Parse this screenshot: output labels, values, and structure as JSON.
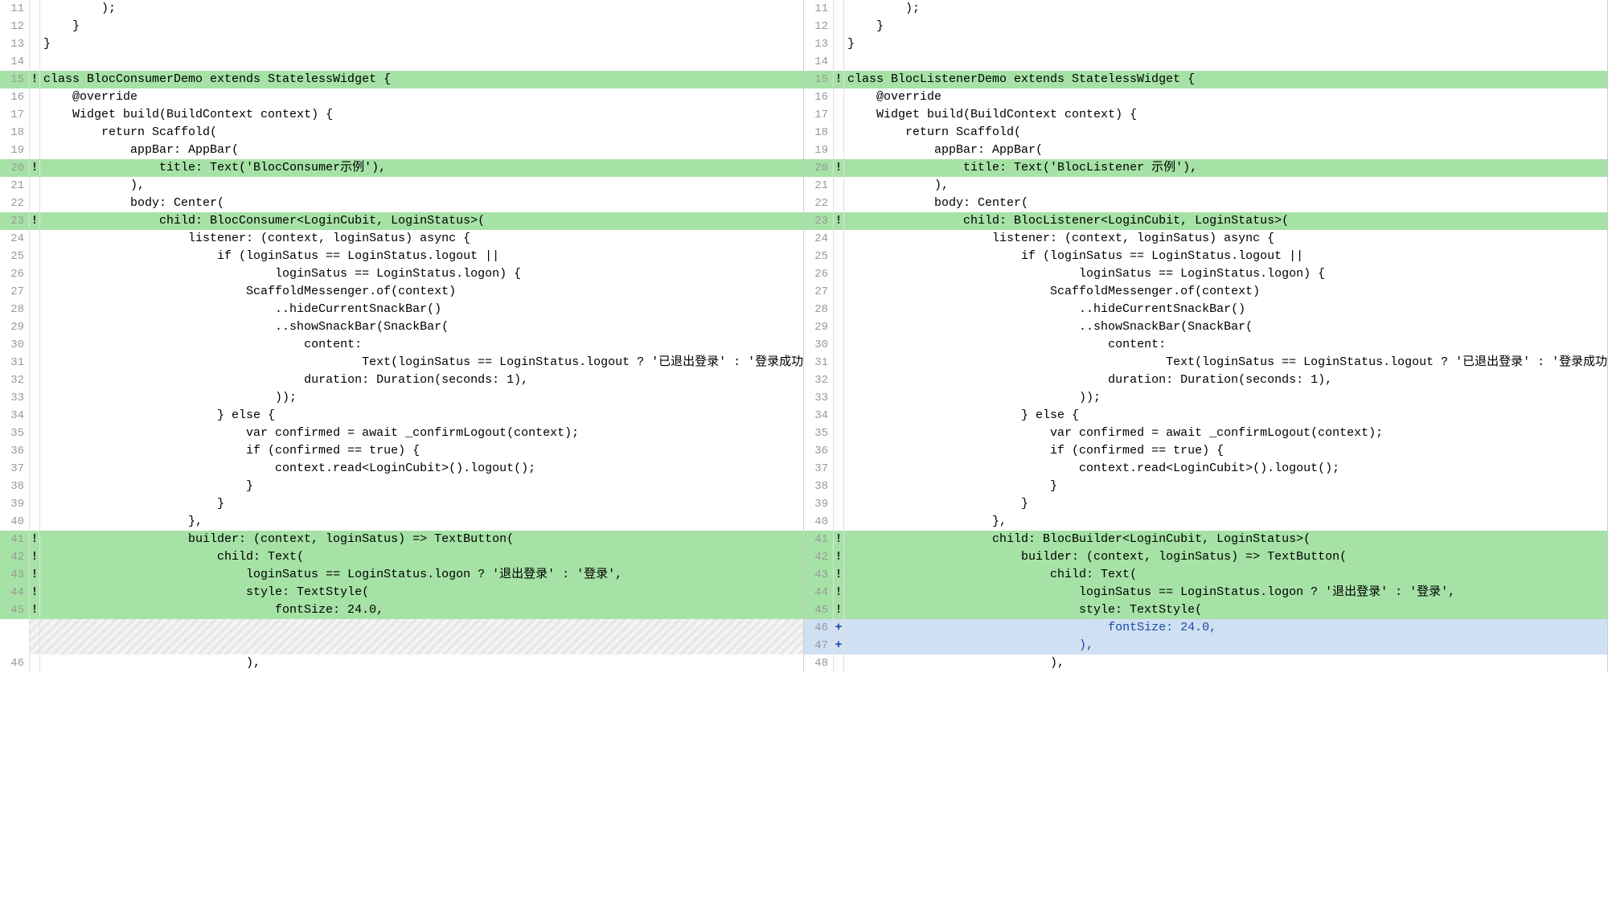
{
  "left": {
    "lines": [
      {
        "num": 11,
        "marker": "",
        "hl": "",
        "indent": 4,
        "text": ");"
      },
      {
        "num": 12,
        "marker": "",
        "hl": "",
        "indent": 2,
        "text": "}"
      },
      {
        "num": 13,
        "marker": "",
        "hl": "",
        "indent": 0,
        "text": "}"
      },
      {
        "num": 14,
        "marker": "",
        "hl": "",
        "indent": 0,
        "text": ""
      },
      {
        "num": 15,
        "marker": "!",
        "hl": "green",
        "indent": 0,
        "text": "class BlocConsumerDemo extends StatelessWidget {"
      },
      {
        "num": 16,
        "marker": "",
        "hl": "",
        "indent": 2,
        "text": "@override"
      },
      {
        "num": 17,
        "marker": "",
        "hl": "",
        "indent": 2,
        "text": "Widget build(BuildContext context) {"
      },
      {
        "num": 18,
        "marker": "",
        "hl": "",
        "indent": 4,
        "text": "return Scaffold("
      },
      {
        "num": 19,
        "marker": "",
        "hl": "",
        "indent": 6,
        "text": "appBar: AppBar("
      },
      {
        "num": 20,
        "marker": "!",
        "hl": "green",
        "indent": 8,
        "text": "title: Text('BlocConsumer示例'),"
      },
      {
        "num": 21,
        "marker": "",
        "hl": "",
        "indent": 6,
        "text": "),"
      },
      {
        "num": 22,
        "marker": "",
        "hl": "",
        "indent": 6,
        "text": "body: Center("
      },
      {
        "num": 23,
        "marker": "!",
        "hl": "green",
        "indent": 8,
        "text": "child: BlocConsumer<LoginCubit, LoginStatus>("
      },
      {
        "num": 24,
        "marker": "",
        "hl": "",
        "indent": 10,
        "text": "listener: (context, loginSatus) async {"
      },
      {
        "num": 25,
        "marker": "",
        "hl": "",
        "indent": 12,
        "text": "if (loginSatus == LoginStatus.logout ||"
      },
      {
        "num": 26,
        "marker": "",
        "hl": "",
        "indent": 16,
        "text": "loginSatus == LoginStatus.logon) {"
      },
      {
        "num": 27,
        "marker": "",
        "hl": "",
        "indent": 14,
        "text": "ScaffoldMessenger.of(context)"
      },
      {
        "num": 28,
        "marker": "",
        "hl": "",
        "indent": 16,
        "text": "..hideCurrentSnackBar()"
      },
      {
        "num": 29,
        "marker": "",
        "hl": "",
        "indent": 16,
        "text": "..showSnackBar(SnackBar("
      },
      {
        "num": 30,
        "marker": "",
        "hl": "",
        "indent": 18,
        "text": "content:"
      },
      {
        "num": 31,
        "marker": "",
        "hl": "",
        "indent": 22,
        "text": "Text(loginSatus == LoginStatus.logout ? '已退出登录' : '登录成功'),"
      },
      {
        "num": 32,
        "marker": "",
        "hl": "",
        "indent": 18,
        "text": "duration: Duration(seconds: 1),"
      },
      {
        "num": 33,
        "marker": "",
        "hl": "",
        "indent": 16,
        "text": "));"
      },
      {
        "num": 34,
        "marker": "",
        "hl": "",
        "indent": 12,
        "text": "} else {"
      },
      {
        "num": 35,
        "marker": "",
        "hl": "",
        "indent": 14,
        "text": "var confirmed = await _confirmLogout(context);"
      },
      {
        "num": 36,
        "marker": "",
        "hl": "",
        "indent": 14,
        "text": "if (confirmed == true) {"
      },
      {
        "num": 37,
        "marker": "",
        "hl": "",
        "indent": 16,
        "text": "context.read<LoginCubit>().logout();"
      },
      {
        "num": 38,
        "marker": "",
        "hl": "",
        "indent": 14,
        "text": "}"
      },
      {
        "num": 39,
        "marker": "",
        "hl": "",
        "indent": 12,
        "text": "}"
      },
      {
        "num": 40,
        "marker": "",
        "hl": "",
        "indent": 10,
        "text": "},"
      },
      {
        "num": 41,
        "marker": "!",
        "hl": "green",
        "indent": 10,
        "text": "builder: (context, loginSatus) => TextButton("
      },
      {
        "num": 42,
        "marker": "!",
        "hl": "green",
        "indent": 12,
        "text": "child: Text("
      },
      {
        "num": 43,
        "marker": "!",
        "hl": "green",
        "indent": 14,
        "text": "loginSatus == LoginStatus.logon ? '退出登录' : '登录',"
      },
      {
        "num": 44,
        "marker": "!",
        "hl": "green",
        "indent": 14,
        "text": "style: TextStyle("
      },
      {
        "num": 45,
        "marker": "!",
        "hl": "green",
        "indent": 16,
        "text": "fontSize: 24.0,"
      },
      {
        "num": "",
        "marker": "",
        "hl": "dashed",
        "indent": 0,
        "text": ""
      },
      {
        "num": "",
        "marker": "",
        "hl": "dashed",
        "indent": 0,
        "text": ""
      },
      {
        "num": 46,
        "marker": "",
        "hl": "",
        "indent": 14,
        "text": "),"
      }
    ]
  },
  "right": {
    "lines": [
      {
        "num": 11,
        "marker": "",
        "hl": "",
        "indent": 4,
        "text": ");"
      },
      {
        "num": 12,
        "marker": "",
        "hl": "",
        "indent": 2,
        "text": "}"
      },
      {
        "num": 13,
        "marker": "",
        "hl": "",
        "indent": 0,
        "text": "}"
      },
      {
        "num": 14,
        "marker": "",
        "hl": "",
        "indent": 0,
        "text": ""
      },
      {
        "num": 15,
        "marker": "!",
        "hl": "green",
        "indent": 0,
        "text": "class BlocListenerDemo extends StatelessWidget {"
      },
      {
        "num": 16,
        "marker": "",
        "hl": "",
        "indent": 2,
        "text": "@override"
      },
      {
        "num": 17,
        "marker": "",
        "hl": "",
        "indent": 2,
        "text": "Widget build(BuildContext context) {"
      },
      {
        "num": 18,
        "marker": "",
        "hl": "",
        "indent": 4,
        "text": "return Scaffold("
      },
      {
        "num": 19,
        "marker": "",
        "hl": "",
        "indent": 6,
        "text": "appBar: AppBar("
      },
      {
        "num": 20,
        "marker": "!",
        "hl": "green",
        "indent": 8,
        "text": "title: Text('BlocListener 示例'),"
      },
      {
        "num": 21,
        "marker": "",
        "hl": "",
        "indent": 6,
        "text": "),"
      },
      {
        "num": 22,
        "marker": "",
        "hl": "",
        "indent": 6,
        "text": "body: Center("
      },
      {
        "num": 23,
        "marker": "!",
        "hl": "green",
        "indent": 8,
        "text": "child: BlocListener<LoginCubit, LoginStatus>("
      },
      {
        "num": 24,
        "marker": "",
        "hl": "",
        "indent": 10,
        "text": "listener: (context, loginSatus) async {"
      },
      {
        "num": 25,
        "marker": "",
        "hl": "",
        "indent": 12,
        "text": "if (loginSatus == LoginStatus.logout ||"
      },
      {
        "num": 26,
        "marker": "",
        "hl": "",
        "indent": 16,
        "text": "loginSatus == LoginStatus.logon) {"
      },
      {
        "num": 27,
        "marker": "",
        "hl": "",
        "indent": 14,
        "text": "ScaffoldMessenger.of(context)"
      },
      {
        "num": 28,
        "marker": "",
        "hl": "",
        "indent": 16,
        "text": "..hideCurrentSnackBar()"
      },
      {
        "num": 29,
        "marker": "",
        "hl": "",
        "indent": 16,
        "text": "..showSnackBar(SnackBar("
      },
      {
        "num": 30,
        "marker": "",
        "hl": "",
        "indent": 18,
        "text": "content:"
      },
      {
        "num": 31,
        "marker": "",
        "hl": "",
        "indent": 22,
        "text": "Text(loginSatus == LoginStatus.logout ? '已退出登录' : '登录成功'),"
      },
      {
        "num": 32,
        "marker": "",
        "hl": "",
        "indent": 18,
        "text": "duration: Duration(seconds: 1),"
      },
      {
        "num": 33,
        "marker": "",
        "hl": "",
        "indent": 16,
        "text": "));"
      },
      {
        "num": 34,
        "marker": "",
        "hl": "",
        "indent": 12,
        "text": "} else {"
      },
      {
        "num": 35,
        "marker": "",
        "hl": "",
        "indent": 14,
        "text": "var confirmed = await _confirmLogout(context);"
      },
      {
        "num": 36,
        "marker": "",
        "hl": "",
        "indent": 14,
        "text": "if (confirmed == true) {"
      },
      {
        "num": 37,
        "marker": "",
        "hl": "",
        "indent": 16,
        "text": "context.read<LoginCubit>().logout();"
      },
      {
        "num": 38,
        "marker": "",
        "hl": "",
        "indent": 14,
        "text": "}"
      },
      {
        "num": 39,
        "marker": "",
        "hl": "",
        "indent": 12,
        "text": "}"
      },
      {
        "num": 40,
        "marker": "",
        "hl": "",
        "indent": 10,
        "text": "},"
      },
      {
        "num": 41,
        "marker": "!",
        "hl": "green",
        "indent": 10,
        "text": "child: BlocBuilder<LoginCubit, LoginStatus>("
      },
      {
        "num": 42,
        "marker": "!",
        "hl": "green",
        "indent": 12,
        "text": "builder: (context, loginSatus) => TextButton("
      },
      {
        "num": 43,
        "marker": "!",
        "hl": "green",
        "indent": 14,
        "text": "child: Text("
      },
      {
        "num": 44,
        "marker": "!",
        "hl": "green",
        "indent": 16,
        "text": "loginSatus == LoginStatus.logon ? '退出登录' : '登录',"
      },
      {
        "num": 45,
        "marker": "!",
        "hl": "green",
        "indent": 16,
        "text": "style: TextStyle("
      },
      {
        "num": 46,
        "marker": "+",
        "hl": "blue",
        "indent": 18,
        "text": "fontSize: 24.0,"
      },
      {
        "num": 47,
        "marker": "+",
        "hl": "blue",
        "indent": 16,
        "text": "),"
      },
      {
        "num": 48,
        "marker": "",
        "hl": "",
        "indent": 14,
        "text": "),"
      }
    ]
  }
}
